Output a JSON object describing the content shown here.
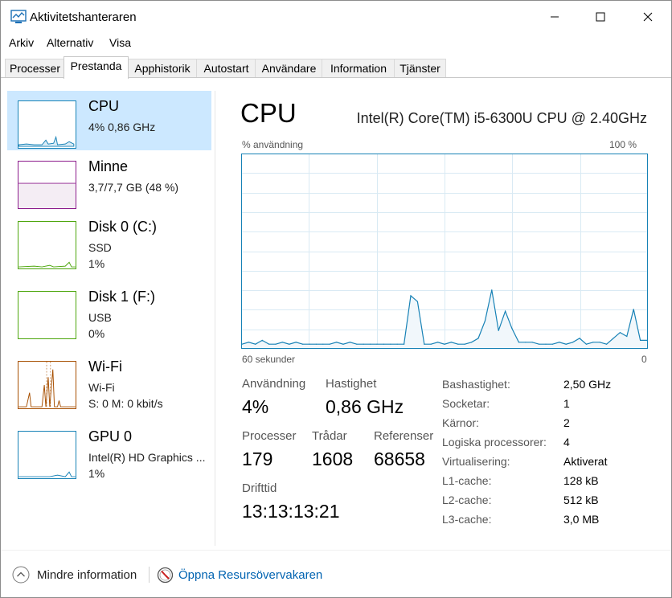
{
  "window": {
    "title": "Aktivitetshanteraren"
  },
  "menu": [
    "Arkiv",
    "Alternativ",
    "Visa"
  ],
  "tabs": [
    "Processer",
    "Prestanda",
    "Apphistorik",
    "Autostart",
    "Användare",
    "Information",
    "Tjänster"
  ],
  "active_tab": "Prestanda",
  "sidebar": {
    "items": [
      {
        "title": "CPU",
        "line1": "4%  0,86 GHz",
        "line2": "",
        "color": "#1782b6"
      },
      {
        "title": "Minne",
        "line1": "3,7/7,7 GB (48 %)",
        "line2": "",
        "color": "#8b1a8b"
      },
      {
        "title": "Disk 0 (C:)",
        "line1": "SSD",
        "line2": "1%",
        "color": "#4da60c"
      },
      {
        "title": "Disk 1 (F:)",
        "line1": "USB",
        "line2": "0%",
        "color": "#4da60c"
      },
      {
        "title": "Wi-Fi",
        "line1": "Wi-Fi",
        "line2": "S: 0  M: 0 kbit/s",
        "color": "#a74f01"
      },
      {
        "title": "GPU 0",
        "line1": "Intel(R) HD Graphics ...",
        "line2": "1%",
        "color": "#1782b6"
      }
    ]
  },
  "main": {
    "title": "CPU",
    "cpu_name": "Intel(R) Core(TM) i5-6300U CPU @ 2.40GHz",
    "graph": {
      "y_label": "% användning",
      "y_max_label": "100 %",
      "x_label_left": "60 sekunder",
      "x_label_right": "0",
      "color": "#1782b6"
    },
    "stats": {
      "usage_label": "Användning",
      "usage": "4%",
      "speed_label": "Hastighet",
      "speed": "0,86 GHz",
      "processes_label": "Processer",
      "processes": "179",
      "threads_label": "Trådar",
      "threads": "1608",
      "handles_label": "Referenser",
      "handles": "68658",
      "uptime_label": "Drifttid",
      "uptime": "13:13:13:21"
    },
    "specs": [
      {
        "label": "Bashastighet:",
        "value": "2,50 GHz"
      },
      {
        "label": "Socketar:",
        "value": "1"
      },
      {
        "label": "Kärnor:",
        "value": "2"
      },
      {
        "label": "Logiska processorer:",
        "value": "4"
      },
      {
        "label": "Virtualisering:",
        "value": "Aktiverat"
      },
      {
        "label": "L1-cache:",
        "value": "128 kB"
      },
      {
        "label": "L2-cache:",
        "value": "512 kB"
      },
      {
        "label": "L3-cache:",
        "value": "3,0 MB"
      }
    ]
  },
  "footer": {
    "fewer_details": "Mindre information",
    "open_resmon": "Öppna Resursövervakaren"
  },
  "chart_data": {
    "type": "area",
    "xlabel": "60 sekunder",
    "ylabel": "% användning",
    "ylim": [
      0,
      100
    ],
    "x": [
      60,
      59,
      58,
      57,
      56,
      55,
      54,
      53,
      52,
      51,
      50,
      49,
      48,
      47,
      46,
      45,
      44,
      43,
      42,
      41,
      40,
      39,
      38,
      37,
      36,
      35,
      34,
      33,
      32,
      31,
      30,
      29,
      28,
      27,
      26,
      25,
      24,
      23,
      22,
      21,
      20,
      19,
      18,
      17,
      16,
      15,
      14,
      13,
      12,
      11,
      10,
      9,
      8,
      7,
      6,
      5,
      4,
      3,
      2,
      1,
      0
    ],
    "series": [
      {
        "values": [
          2,
          3,
          2,
          4,
          2,
          2,
          3,
          2,
          3,
          2,
          2,
          2,
          2,
          2,
          3,
          2,
          3,
          2,
          2,
          2,
          2,
          2,
          2,
          2,
          2,
          27,
          24,
          2,
          2,
          3,
          2,
          3,
          2,
          2,
          3,
          5,
          14,
          30,
          9,
          19,
          10,
          3,
          3,
          3,
          2,
          2,
          2,
          3,
          2,
          3,
          5,
          2,
          3,
          3,
          2,
          5,
          8,
          6,
          20,
          4,
          4
        ]
      }
    ]
  }
}
